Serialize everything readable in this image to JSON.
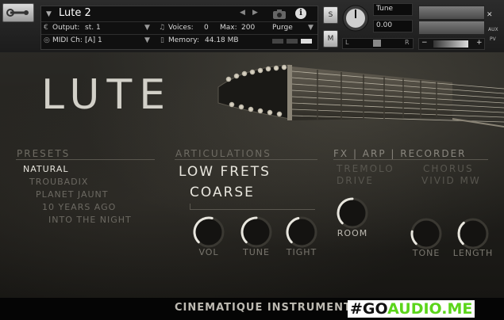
{
  "header": {
    "instrument_name": "Lute 2",
    "output_label": "Output:",
    "output_value": "st. 1",
    "voices_label": "Voices:",
    "voices_value": "0",
    "max_label": "Max:",
    "max_value": "200",
    "purge_label": "Purge",
    "midi_label": "MIDI Ch:",
    "midi_value": "[A]  1",
    "memory_label": "Memory:",
    "memory_value": "44.18 MB",
    "solo_label": "S",
    "mute_label": "M",
    "tune_label": "Tune",
    "tune_value": "0.00",
    "pan_left": "L",
    "pan_right": "R",
    "vol_minus": "−",
    "vol_plus": "+",
    "aux_label": "AUX",
    "pv_label": "PV"
  },
  "main": {
    "title": "LUTE",
    "presets": {
      "title": "PRESETS",
      "items": [
        {
          "label": "NATURAL",
          "selected": true
        },
        {
          "label": "TROUBADIX",
          "selected": false
        },
        {
          "label": "PLANET JAUNT",
          "selected": false
        },
        {
          "label": "10 YEARS AGO",
          "selected": false
        },
        {
          "label": "INTO THE NIGHT",
          "selected": false
        }
      ]
    },
    "articulations": {
      "title": "ARTICULATIONS",
      "items": [
        "LOW FRETS",
        "COARSE"
      ],
      "knobs": [
        {
          "label": "VOL",
          "value": 0.55
        },
        {
          "label": "TUNE",
          "value": 0.5
        },
        {
          "label": "TIGHT",
          "value": 0.45
        }
      ]
    },
    "fx": {
      "tabs": "FX  |  ARP  |  RECORDER",
      "options_left": [
        "TREMOLO",
        "DRIVE"
      ],
      "options_right": [
        "CHORUS",
        "VIVID MW"
      ],
      "knobs": [
        {
          "label": "ROOM",
          "value": 0.5
        },
        {
          "label": "TONE",
          "value": 0.2
        },
        {
          "label": "LENGTH",
          "value": 0.35
        }
      ]
    }
  },
  "footer": {
    "brand": "CINEMATIQUE INSTRUMENTS",
    "watermark_a": "#GO",
    "watermark_b": "AUDIO.ME"
  },
  "colors": {
    "text_light": "#e6e4dc",
    "text_dim": "#6c6962",
    "knob_arc": "#e8e6de",
    "watermark_green": "#5bd51a"
  }
}
